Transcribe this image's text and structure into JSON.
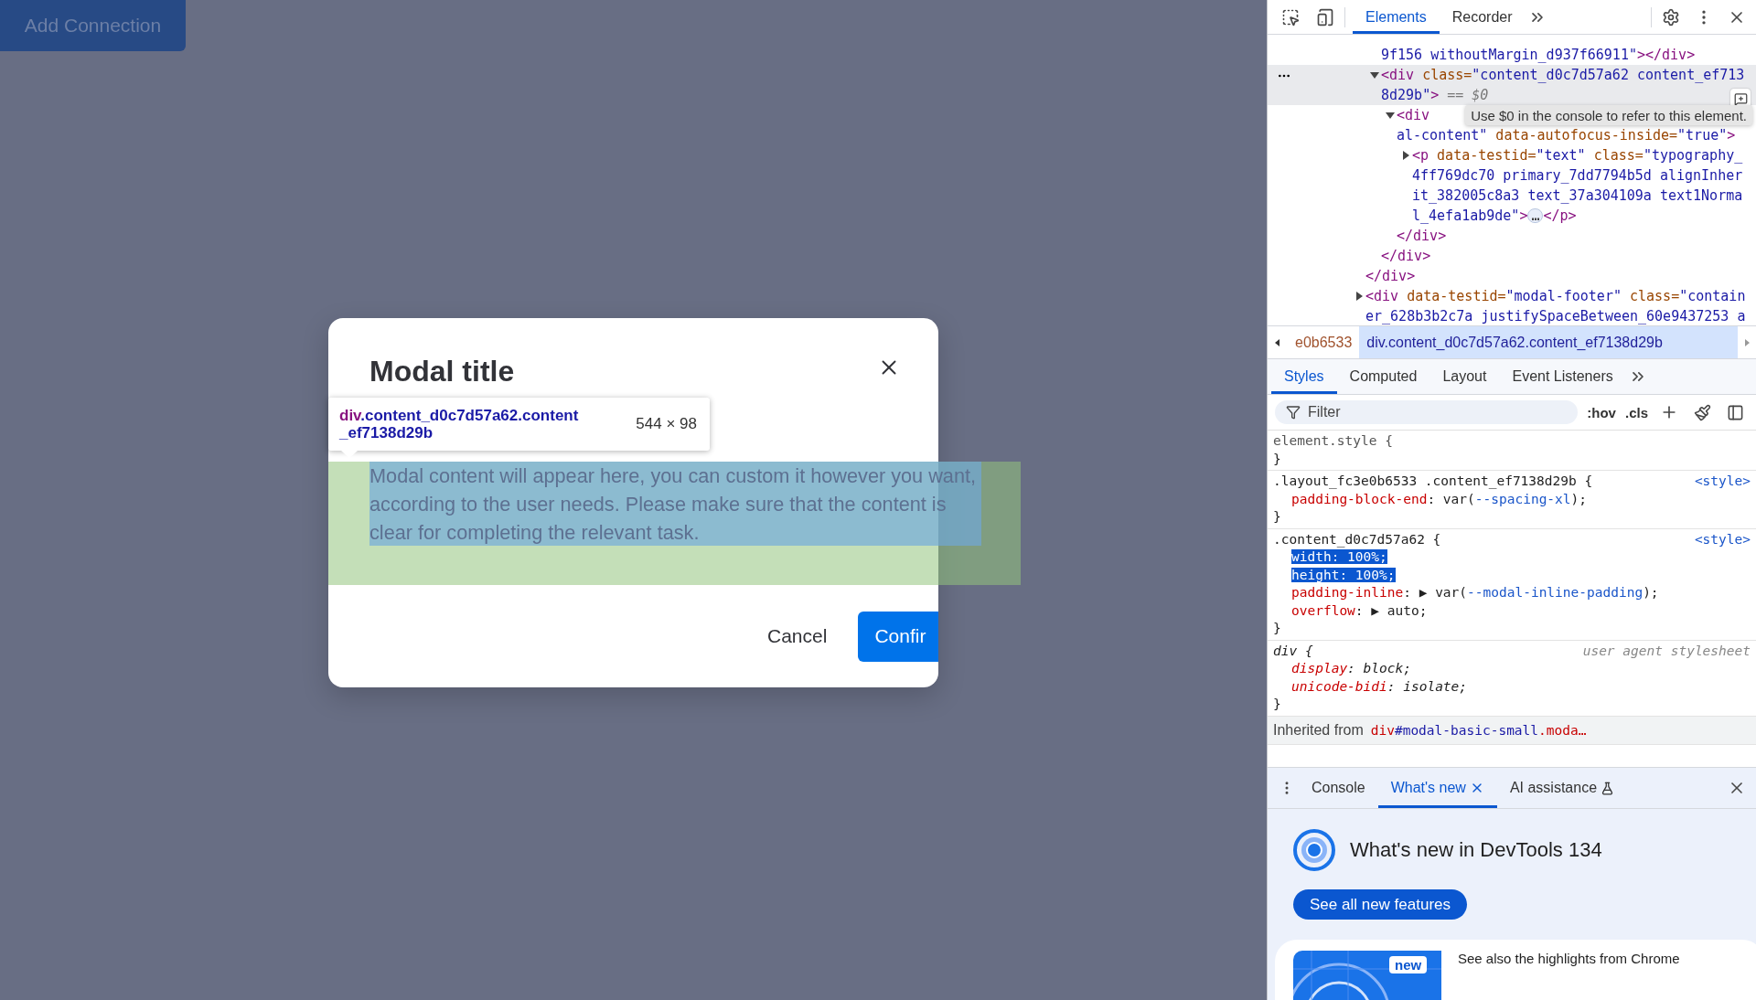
{
  "page": {
    "button": "Add Connection"
  },
  "modal": {
    "title": "Modal title",
    "body": "Modal content will appear here, you can custom it however you want, according to the user needs. Please make sure that the content is clear for completing the relevant task.",
    "buttons": [
      {
        "kind": "text",
        "label": "Cancel"
      },
      {
        "kind": "primary",
        "label": "Confir"
      }
    ]
  },
  "inspect_tooltip": {
    "tag": "div",
    "selector": ".content_d0c7d57a62.content_ef7138d29b",
    "size": "544 × 98"
  },
  "devtools": {
    "top_tabs": [
      {
        "label": "Elements",
        "selected": true
      },
      {
        "label": "Recorder",
        "selected": false
      }
    ],
    "dom_tree": [
      {
        "kind": "scrolled-parent",
        "close": "</div>",
        "children": [
          {
            "kind": "tail",
            "parts": [
              {
                "kind": "value",
                "text": "9f156 withoutMargin_d937f66911\""
              },
              {
                "kind": "tag",
                "text": "></div>"
              }
            ]
          },
          {
            "kind": "element",
            "expanded": true,
            "selected": true,
            "close": "</div>",
            "parts": [
              {
                "kind": "tag",
                "text": "<div"
              },
              {
                "kind": "attr",
                "text": " class="
              },
              {
                "kind": "value",
                "text": "\"content_d0c7d57a62 content_ef713"
              },
              {
                "kind": "break"
              },
              {
                "kind": "value",
                "text": "8d29b\""
              },
              {
                "kind": "tag",
                "text": ">"
              },
              {
                "kind": "hint",
                "text": " == $0"
              }
            ],
            "children": [
              {
                "kind": "element",
                "expanded": true,
                "selected": false,
                "close": "</div>",
                "parts": [
                  {
                    "kind": "tag",
                    "text": "<div"
                  },
                  {
                    "kind": "break"
                  },
                  {
                    "kind": "value",
                    "text": "al-content\""
                  },
                  {
                    "kind": "attr",
                    "text": " data-autofocus-inside="
                  },
                  {
                    "kind": "value",
                    "text": "\"true\""
                  },
                  {
                    "kind": "tag",
                    "text": ">"
                  }
                ],
                "children": [
                  {
                    "kind": "element",
                    "expanded": false,
                    "selected": false,
                    "parts": [
                      {
                        "kind": "tag",
                        "text": "<p"
                      },
                      {
                        "kind": "attr",
                        "text": " data-testid="
                      },
                      {
                        "kind": "value",
                        "text": "\"text\""
                      },
                      {
                        "kind": "attr",
                        "text": " class="
                      },
                      {
                        "kind": "value",
                        "text": "\"typography_"
                      },
                      {
                        "kind": "break"
                      },
                      {
                        "kind": "value",
                        "text": "4ff769dc70 primary_7dd7794b5d alignInher"
                      },
                      {
                        "kind": "break"
                      },
                      {
                        "kind": "value",
                        "text": "it_382005c8a3 text_37a304109a text1Norma"
                      },
                      {
                        "kind": "break"
                      },
                      {
                        "kind": "value",
                        "text": "l_4efa1ab9de\""
                      },
                      {
                        "kind": "tag",
                        "text": ">"
                      },
                      {
                        "kind": "ellipsis",
                        "text": "…"
                      },
                      {
                        "kind": "tag",
                        "text": "</p>"
                      }
                    ]
                  }
                ]
              }
            ]
          }
        ]
      },
      {
        "kind": "element",
        "expanded": false,
        "selected": false,
        "parts": [
          {
            "kind": "tag",
            "text": "<div"
          },
          {
            "kind": "attr",
            "text": " data-testid="
          },
          {
            "kind": "value",
            "text": "\"modal-footer\""
          },
          {
            "kind": "attr",
            "text": " class="
          },
          {
            "kind": "value",
            "text": "\"contain"
          },
          {
            "kind": "break"
          },
          {
            "kind": "value",
            "text": "er_628b3b2c7a justifySpaceBetween_60e9437253 a"
          }
        ]
      }
    ],
    "dom_tooltip": "Use $0 in the console to refer to this element.",
    "breadcrumbs": [
      {
        "text": "e0b6533",
        "selected": false
      },
      {
        "text": "div.content_d0c7d57a62.content_ef7138d29b",
        "selected": true
      }
    ],
    "styles_tabs": [
      {
        "label": "Styles",
        "selected": true
      },
      {
        "label": "Computed",
        "selected": false
      },
      {
        "label": "Layout",
        "selected": false
      },
      {
        "label": "Event Listeners",
        "selected": false
      }
    ],
    "filter": {
      "placeholder": "Filter",
      "hov": ":hov",
      "cls": ".cls"
    },
    "rules": [
      {
        "kind": "inline",
        "selector": "element.style {",
        "close": "}"
      },
      {
        "kind": "author",
        "selector": ".layout_fc3e0b6533 .content_ef7138d29b {",
        "source": "<style>",
        "close": "}",
        "declarations": [
          {
            "property": "padding-block-end",
            "value": ": var(--spacing-xl);",
            "highlighted": false
          }
        ]
      },
      {
        "kind": "author",
        "selector": ".content_d0c7d57a62 {",
        "source": "<style>",
        "close": "}",
        "declarations": [
          {
            "property": "width",
            "value": ": 100%;",
            "highlighted": true
          },
          {
            "property": "height",
            "value": ": 100%;",
            "highlighted": true
          },
          {
            "property": "padding-inline",
            "value": ": ▶ var(--modal-inline-padding);",
            "highlighted": false
          },
          {
            "property": "overflow",
            "value": ": ▶ auto;",
            "highlighted": false
          }
        ]
      },
      {
        "kind": "user-agent",
        "selector": "div {",
        "source": "user agent stylesheet",
        "close": "}",
        "declarations": [
          {
            "property": "display",
            "value": ": block;",
            "highlighted": false
          },
          {
            "property": "unicode-bidi",
            "value": ": isolate;",
            "highlighted": false
          }
        ]
      }
    ],
    "inherited": {
      "label": "Inherited from",
      "selector": "div#modal-basic-small.moda…"
    },
    "drawer_tabs": [
      {
        "label": "Console",
        "selected": false
      },
      {
        "label": "What's new",
        "selected": true,
        "closable": true
      },
      {
        "label": "AI assistance",
        "selected": false,
        "experimental": true
      }
    ],
    "whats_new": {
      "title": "What's new in DevTools 134",
      "button": "See all new features",
      "card_badge": "new",
      "card_text": "See also the highlights from Chrome"
    }
  }
}
